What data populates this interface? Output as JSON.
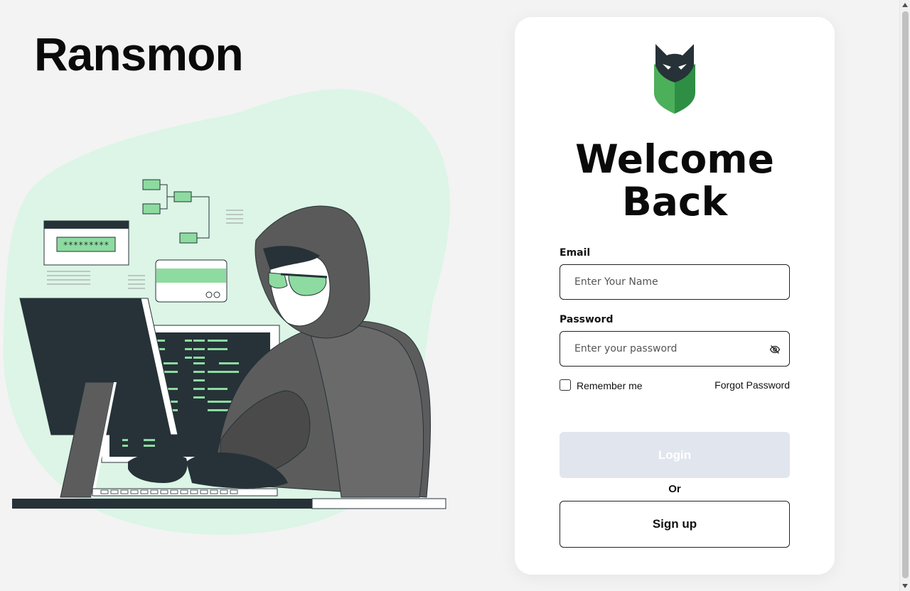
{
  "app": {
    "brand": "Ransmon"
  },
  "login": {
    "title_line1": "Welcome",
    "title_line2": "Back",
    "email_label": "Email",
    "email_placeholder": "Enter Your Name",
    "email_value": "",
    "password_label": "Password",
    "password_placeholder": "Enter your password",
    "password_value": "",
    "password_toggle_icon": "eye-off-icon",
    "remember_label": "Remember me",
    "remember_checked": false,
    "forgot_label": "Forgot Password",
    "login_label": "Login",
    "login_disabled": true,
    "or_label": "Or",
    "signup_label": "Sign up"
  },
  "illustration": {
    "password_mask": "*********",
    "icons": [
      "hacker-illustration",
      "shield-fox-logo"
    ]
  },
  "colors": {
    "accent_green": "#8ddba0",
    "blob_green": "#dcf5e6",
    "dark": "#263238",
    "login_disabled_bg": "#e1e6ee"
  }
}
